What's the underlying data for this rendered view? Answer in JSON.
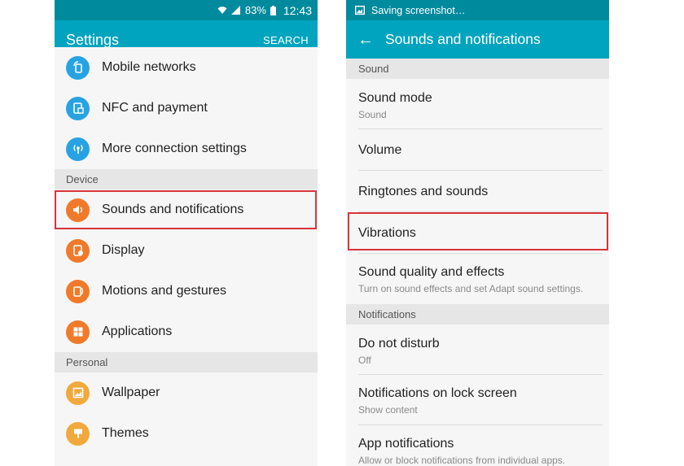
{
  "left": {
    "status": {
      "battery": "83%",
      "time": "12:43"
    },
    "title": "Settings",
    "search": "SEARCH",
    "items_top": [
      {
        "label": "Mobile networks",
        "icon": "mobile-networks-icon"
      },
      {
        "label": "NFC and payment",
        "icon": "nfc-icon"
      },
      {
        "label": "More connection settings",
        "icon": "connection-icon"
      }
    ],
    "section_device": "Device",
    "items_device": [
      {
        "label": "Sounds and notifications",
        "icon": "speaker-icon"
      },
      {
        "label": "Display",
        "icon": "display-icon"
      },
      {
        "label": "Motions and gestures",
        "icon": "motions-icon"
      },
      {
        "label": "Applications",
        "icon": "applications-icon"
      }
    ],
    "section_personal": "Personal",
    "items_personal": [
      {
        "label": "Wallpaper",
        "icon": "wallpaper-icon"
      },
      {
        "label": "Themes",
        "icon": "themes-icon"
      }
    ]
  },
  "right": {
    "status": {
      "text": "Saving screenshot…"
    },
    "title": "Sounds and notifications",
    "section_sound": "Sound",
    "sound_items": [
      {
        "title": "Sound mode",
        "subtitle": "Sound"
      },
      {
        "title": "Volume"
      },
      {
        "title": "Ringtones and sounds"
      },
      {
        "title": "Vibrations"
      },
      {
        "title": "Sound quality and effects",
        "subtitle": "Turn on sound effects and set Adapt sound settings."
      }
    ],
    "section_notifications": "Notifications",
    "notification_items": [
      {
        "title": "Do not disturb",
        "subtitle": "Off"
      },
      {
        "title": "Notifications on lock screen",
        "subtitle": "Show content"
      },
      {
        "title": "App notifications",
        "subtitle": "Allow or block notifications from individual apps."
      }
    ]
  },
  "colors": {
    "statusbar": "#008a9d",
    "appbar": "#00a4be",
    "highlight": "#d8343c",
    "blue_icon": "#27a3e3",
    "orange_icon": "#f07a2a",
    "yellow_icon": "#f2a93b"
  }
}
